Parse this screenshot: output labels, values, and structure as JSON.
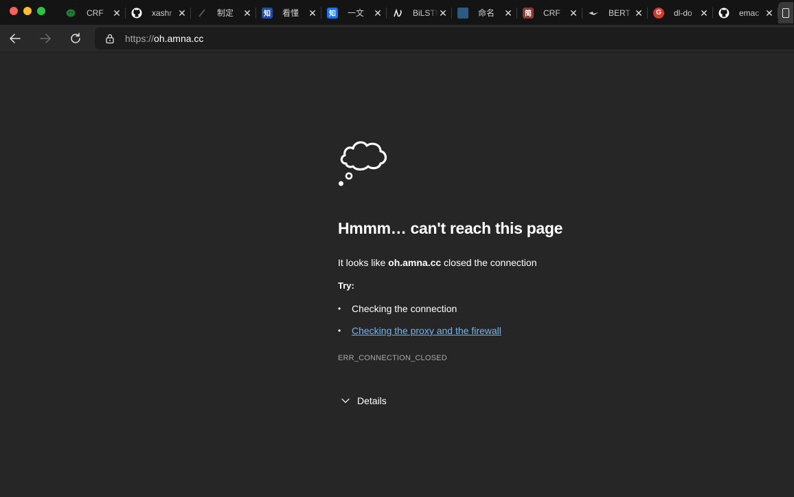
{
  "tabs": [
    {
      "title": "CRF",
      "favicon": "wechat-icon",
      "color": "#1f7a32"
    },
    {
      "title": "xashr",
      "favicon": "github-icon",
      "color": "#ffffff"
    },
    {
      "title": "制定",
      "favicon": "document-icon",
      "color": "#3a3a3a"
    },
    {
      "title": "看懂",
      "favicon": "zhihu-icon",
      "color": "#1f4fae",
      "glyph": "知"
    },
    {
      "title": "一文",
      "favicon": "zhihu-icon",
      "color": "#1772f6",
      "glyph": "知"
    },
    {
      "title": "BiLSTM",
      "favicon": "omega-icon",
      "color": "#ffffff"
    },
    {
      "title": "命名",
      "favicon": "python-icon",
      "color": "#2b5b84"
    },
    {
      "title": "CRF",
      "favicon": "jianshu-icon",
      "color": "#8a3a32",
      "glyph": "简"
    },
    {
      "title": "BERT",
      "favicon": "bird-icon",
      "color": "#141414"
    },
    {
      "title": "dl-do",
      "favicon": "google-icon",
      "color": "#d33a2c",
      "glyph": "G"
    },
    {
      "title": "emac",
      "favicon": "github-icon",
      "color": "#ffffff",
      "active": true
    }
  ],
  "address": {
    "scheme": "https://",
    "host": "oh.amna.cc"
  },
  "error": {
    "title": "Hmmm… can't reach this page",
    "message_prefix": "It looks like ",
    "message_host": "oh.amna.cc",
    "message_suffix": " closed the connection",
    "try_label": "Try:",
    "suggestion_1": "Checking the connection",
    "suggestion_2": "Checking the proxy and the firewall",
    "code": "ERR_CONNECTION_CLOSED",
    "details_label": "Details"
  },
  "icons": {
    "back": "back-arrow-icon",
    "forward": "forward-arrow-icon",
    "reload": "reload-icon",
    "lock": "lock-icon",
    "cloud": "thought-cloud-icon"
  }
}
